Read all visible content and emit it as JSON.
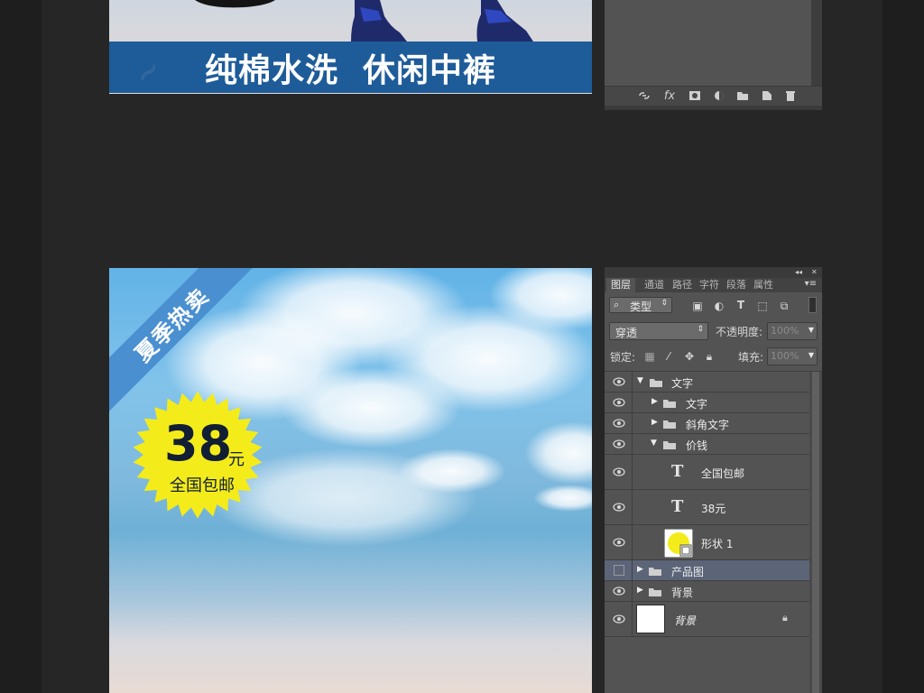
{
  "banner_top": {
    "headline": "纯棉水洗  休闲中裤"
  },
  "panel_top": {
    "footer_icons": [
      "link-icon",
      "fx-icon",
      "mask-icon",
      "adjustment-icon",
      "folder-icon",
      "new-layer-icon",
      "trash-icon"
    ],
    "fx_label": "fx"
  },
  "product": {
    "ribbon_text": "夏季热卖",
    "badge": {
      "price": "38",
      "unit": "元",
      "shipping": "全国包邮"
    },
    "badge_color": "#f4ec1a",
    "ribbon_color": "#4a8fd0"
  },
  "layers_panel": {
    "tabs": [
      "图层",
      "通道",
      "路径",
      "字符",
      "段落",
      "属性"
    ],
    "active_tab": "图层",
    "filter_type": "类型",
    "blend_mode": "穿透",
    "opacity_label": "不透明度:",
    "opacity_value": "100%",
    "lock_label": "锁定:",
    "fill_label": "填充:",
    "fill_value": "100%",
    "layers": [
      {
        "name": "文字",
        "kind": "group-open",
        "level": 0,
        "visible": true
      },
      {
        "name": "文字",
        "kind": "group-closed",
        "level": 1,
        "visible": true
      },
      {
        "name": "斜角文字",
        "kind": "group-closed",
        "level": 1,
        "visible": true
      },
      {
        "name": "价钱",
        "kind": "group-open",
        "level": 1,
        "visible": true
      },
      {
        "name": "全国包邮",
        "kind": "text",
        "level": 2,
        "visible": true
      },
      {
        "name": "38元",
        "kind": "text",
        "level": 2,
        "visible": true
      },
      {
        "name": "形状 1",
        "kind": "shape",
        "level": 2,
        "visible": true
      },
      {
        "name": "产品图",
        "kind": "group-closed",
        "level": 0,
        "visible": false,
        "selected": true
      },
      {
        "name": "背景",
        "kind": "group-closed",
        "level": 0,
        "visible": true
      },
      {
        "name": "背景",
        "kind": "background",
        "level": 0,
        "visible": true,
        "locked": true
      }
    ],
    "selection_color": "#5c6478",
    "panel_bg_color": "#535353"
  },
  "colors": {
    "canvas_bg": "#262626",
    "banner_strip": "#1e5c99"
  }
}
